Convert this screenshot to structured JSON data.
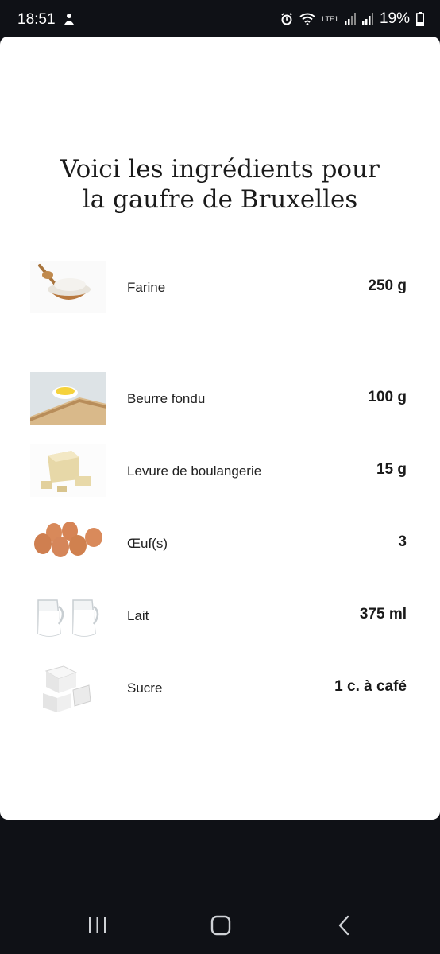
{
  "status_bar": {
    "time": "18:51",
    "network_label": "LTE1",
    "battery_percent": "19%"
  },
  "content": {
    "title_line1": "Voici les ingrédients pour",
    "title_line2": "la gaufre de Bruxelles",
    "ingredients": [
      {
        "name": "Farine",
        "quantity": "250 g",
        "icon": "flour-bowl-image"
      },
      {
        "name": "Beurre fondu",
        "quantity": "100 g",
        "icon": "melted-butter-image"
      },
      {
        "name": "Levure de boulangerie",
        "quantity": "15 g",
        "icon": "yeast-image"
      },
      {
        "name": "Œuf(s)",
        "quantity": "3",
        "icon": "eggs-image"
      },
      {
        "name": "Lait",
        "quantity": "375 ml",
        "icon": "milk-jugs-image"
      },
      {
        "name": "Sucre",
        "quantity": "1 c. à café",
        "icon": "sugar-cubes-image"
      }
    ]
  },
  "nav_bar": {
    "buttons": [
      "recent-apps",
      "home",
      "back"
    ]
  }
}
